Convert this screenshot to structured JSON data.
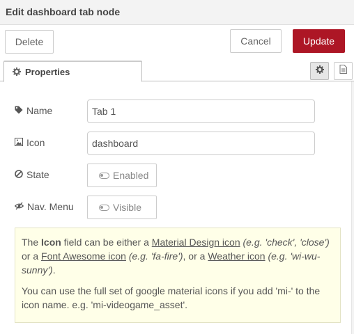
{
  "dialog": {
    "title": "Edit dashboard tab node"
  },
  "toolbar": {
    "delete_label": "Delete",
    "cancel_label": "Cancel",
    "update_label": "Update"
  },
  "colors": {
    "update_bg": "#ad1625",
    "tip_bg": "#ffffe8"
  },
  "tabs": {
    "properties_label": "Properties",
    "settings_icon": "gear-icon",
    "info_icon": "document-icon"
  },
  "form": {
    "name_label": "Name",
    "name_value": "Tab 1",
    "icon_label": "Icon",
    "icon_value": "dashboard",
    "state_label": "State",
    "state_value": "Enabled",
    "nav_label": "Nav. Menu",
    "nav_value": "Visible"
  },
  "tip": {
    "p1_a": "The ",
    "p1_icon_word": "Icon",
    "p1_b": " field can be either a ",
    "p1_link_material": "Material Design icon",
    "p1_c": " ",
    "p1_ex_material": "(e.g. 'check', 'close')",
    "p1_d": " or a ",
    "p1_link_fa": "Font Awesome icon",
    "p1_e": " ",
    "p1_ex_fa": "(e.g. 'fa-fire')",
    "p1_f": ", or a ",
    "p1_link_weather": "Weather icon",
    "p1_g": " ",
    "p1_ex_weather": "(e.g. 'wi-wu-sunny')",
    "p1_h": ".",
    "p2": "You can use the full set of google material icons if you add 'mi-' to the icon name. e.g. 'mi-videogame_asset'."
  }
}
